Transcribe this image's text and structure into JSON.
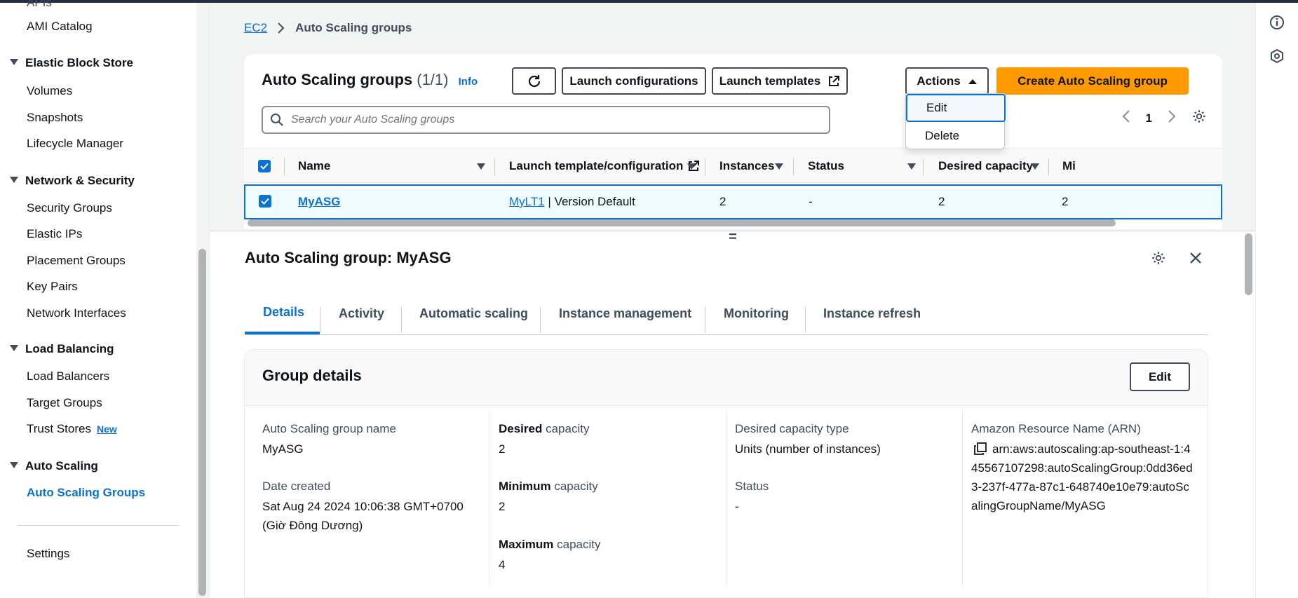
{
  "sidebar": {
    "cut_item": "APIs",
    "ami_catalog": "AMI Catalog",
    "sections": {
      "ebs": {
        "title": "Elastic Block Store",
        "items": [
          "Volumes",
          "Snapshots",
          "Lifecycle Manager"
        ]
      },
      "network": {
        "title": "Network & Security",
        "items": [
          "Security Groups",
          "Elastic IPs",
          "Placement Groups",
          "Key Pairs",
          "Network Interfaces"
        ]
      },
      "lb": {
        "title": "Load Balancing",
        "items": [
          "Load Balancers",
          "Target Groups",
          "Trust Stores"
        ],
        "new_badge": "New"
      },
      "as": {
        "title": "Auto Scaling",
        "items": [
          "Auto Scaling Groups"
        ]
      }
    },
    "settings": "Settings"
  },
  "breadcrumb": {
    "root": "EC2",
    "current": "Auto Scaling groups"
  },
  "table": {
    "title": "Auto Scaling groups",
    "count": "(1/1)",
    "info": "Info",
    "buttons": {
      "launch_configurations": "Launch configurations",
      "launch_templates": "Launch templates",
      "actions": "Actions",
      "create": "Create Auto Scaling group"
    },
    "search_placeholder": "Search your Auto Scaling groups",
    "page": "1",
    "columns": [
      "Name",
      "Launch template/configuration",
      "Instances",
      "Status",
      "Desired capacity",
      "Mi"
    ],
    "rows": [
      {
        "name": "MyASG",
        "template_link": "MyLT1",
        "template_rest": " | Version Default",
        "instances": "2",
        "status": "-",
        "desired": "2",
        "min": "2"
      }
    ]
  },
  "actions_menu": [
    "Edit",
    "Delete"
  ],
  "panel": {
    "title": "Auto Scaling group: MyASG",
    "tabs": [
      "Details",
      "Activity",
      "Automatic scaling",
      "Instance management",
      "Monitoring",
      "Instance refresh"
    ],
    "group_details": {
      "title": "Group details",
      "edit": "Edit",
      "name_label": "Auto Scaling group name",
      "name_value": "MyASG",
      "date_label": "Date created",
      "date_value": "Sat Aug 24 2024 10:06:38 GMT+0700 (Giờ Đông Dương)",
      "desired_bold": "Desired",
      "desired_rest": " capacity",
      "desired_value": "2",
      "min_bold": "Minimum",
      "min_rest": " capacity",
      "min_value": "2",
      "max_bold": "Maximum",
      "max_rest": " capacity",
      "max_value": "4",
      "dct_label": "Desired capacity type",
      "dct_value": "Units (number of instances)",
      "status_label": "Status",
      "status_value": "-",
      "arn_label": "Amazon Resource Name (ARN)",
      "arn_value": "arn:aws:autoscaling:ap-southeast-1:445567107298:autoScalingGroup:0dd36ed3-237f-477a-87c1-648740e10e79:autoScalingGroupName/MyASG"
    }
  },
  "colors": {
    "accent": "#0972d3",
    "primary_button": "#ff9900"
  }
}
